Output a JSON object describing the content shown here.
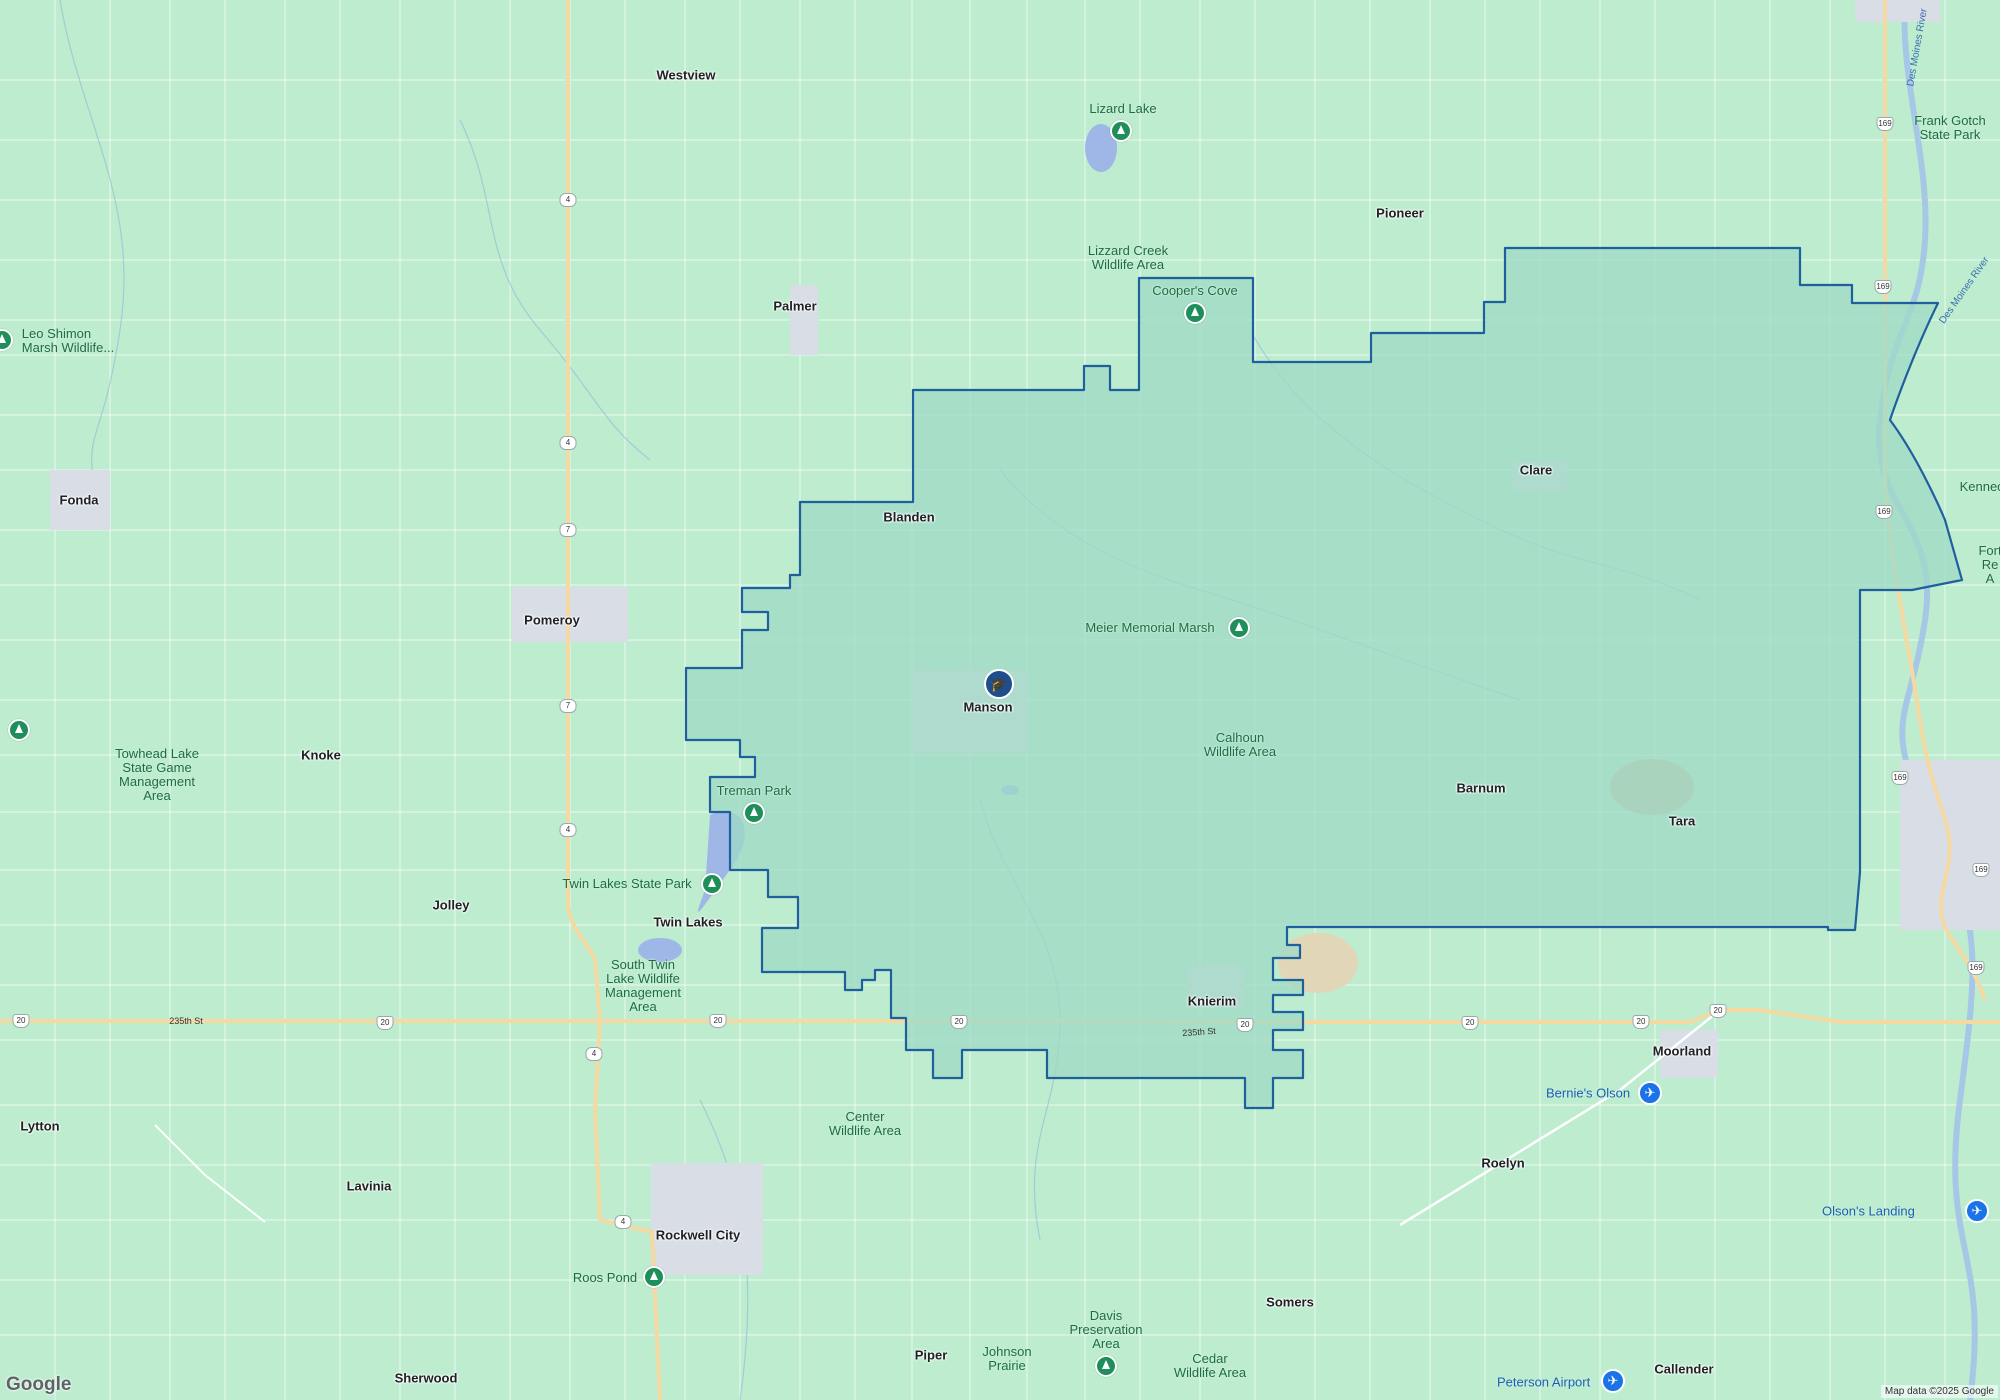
{
  "map": {
    "colors": {
      "land": "#bdeccf",
      "district_fill": "#9fd9c6",
      "district_outline": "#1f5f9e",
      "town": "#d9dde6",
      "highway": "#f5d9a2",
      "road": "#ffffff"
    },
    "towns": [
      {
        "id": "westview",
        "name": "Westview"
      },
      {
        "id": "pioneer",
        "name": "Pioneer"
      },
      {
        "id": "palmer",
        "name": "Palmer"
      },
      {
        "id": "fonda",
        "name": "Fonda"
      },
      {
        "id": "blanden",
        "name": "Blanden"
      },
      {
        "id": "clare",
        "name": "Clare"
      },
      {
        "id": "pomeroy",
        "name": "Pomeroy"
      },
      {
        "id": "manson",
        "name": "Manson"
      },
      {
        "id": "knoke",
        "name": "Knoke"
      },
      {
        "id": "barnum",
        "name": "Barnum"
      },
      {
        "id": "tara",
        "name": "Tara"
      },
      {
        "id": "jolley",
        "name": "Jolley"
      },
      {
        "id": "twin-lakes",
        "name": "Twin Lakes"
      },
      {
        "id": "knierim",
        "name": "Knierim"
      },
      {
        "id": "moorland",
        "name": "Moorland"
      },
      {
        "id": "lytton",
        "name": "Lytton"
      },
      {
        "id": "roelyn",
        "name": "Roelyn"
      },
      {
        "id": "lavinia",
        "name": "Lavinia"
      },
      {
        "id": "rockwell-city",
        "name": "Rockwell City"
      },
      {
        "id": "somers",
        "name": "Somers"
      },
      {
        "id": "piper",
        "name": "Piper"
      },
      {
        "id": "sherwood",
        "name": "Sherwood"
      },
      {
        "id": "callender",
        "name": "Callender"
      }
    ],
    "parks": [
      {
        "id": "lizard-lake",
        "name": "Lizard Lake"
      },
      {
        "id": "frank-gotch",
        "name": "Frank Gotch\nState Park"
      },
      {
        "id": "lizzard-creek",
        "name": "Lizzard Creek\nWildlife Area"
      },
      {
        "id": "coopers-cove",
        "name": "Cooper's Cove"
      },
      {
        "id": "leo-shimon",
        "name": "Leo Shimon\nMarsh Wildlife..."
      },
      {
        "id": "meier-marsh",
        "name": "Meier Memorial Marsh"
      },
      {
        "id": "calhoun-wa",
        "name": "Calhoun\nWildlife Area"
      },
      {
        "id": "towhead",
        "name": "Towhead Lake\nState Game\nManagement\nArea"
      },
      {
        "id": "treman",
        "name": "Treman Park"
      },
      {
        "id": "twin-lakes-sp",
        "name": "Twin Lakes State Park"
      },
      {
        "id": "south-twin",
        "name": "South Twin\nLake Wildlife\nManagement\nArea"
      },
      {
        "id": "center-wa",
        "name": "Center\nWildlife Area"
      },
      {
        "id": "roos-pond",
        "name": "Roos Pond"
      },
      {
        "id": "davis",
        "name": "Davis\nPreservation\nArea"
      },
      {
        "id": "johnson-prairie",
        "name": "Johnson\nPrairie"
      },
      {
        "id": "cedar-wa",
        "name": "Cedar\nWildlife Area"
      },
      {
        "id": "kenneo",
        "name": "Kenneo"
      },
      {
        "id": "fort-re",
        "name": "Fort\nRe\nA"
      }
    ],
    "airports": [
      {
        "id": "bernies-olson",
        "name": "Bernie's Olson"
      },
      {
        "id": "olsons-landing",
        "name": "Olson's Landing"
      },
      {
        "id": "peterson-airport",
        "name": "Peterson Airport"
      }
    ],
    "road_labels": {
      "st235_west": "235th St",
      "st235_east": "235th St",
      "river": "Des Moines River"
    },
    "shields": [
      "4",
      "4",
      "7",
      "7",
      "4",
      "4",
      "4",
      "20",
      "20",
      "20",
      "20",
      "20",
      "20",
      "20",
      "169",
      "169",
      "169",
      "169",
      "169",
      "169",
      "20"
    ],
    "school_icon": "graduation-cap-icon",
    "google_logo": "Google",
    "attribution": "Map data ©2025 Google"
  }
}
